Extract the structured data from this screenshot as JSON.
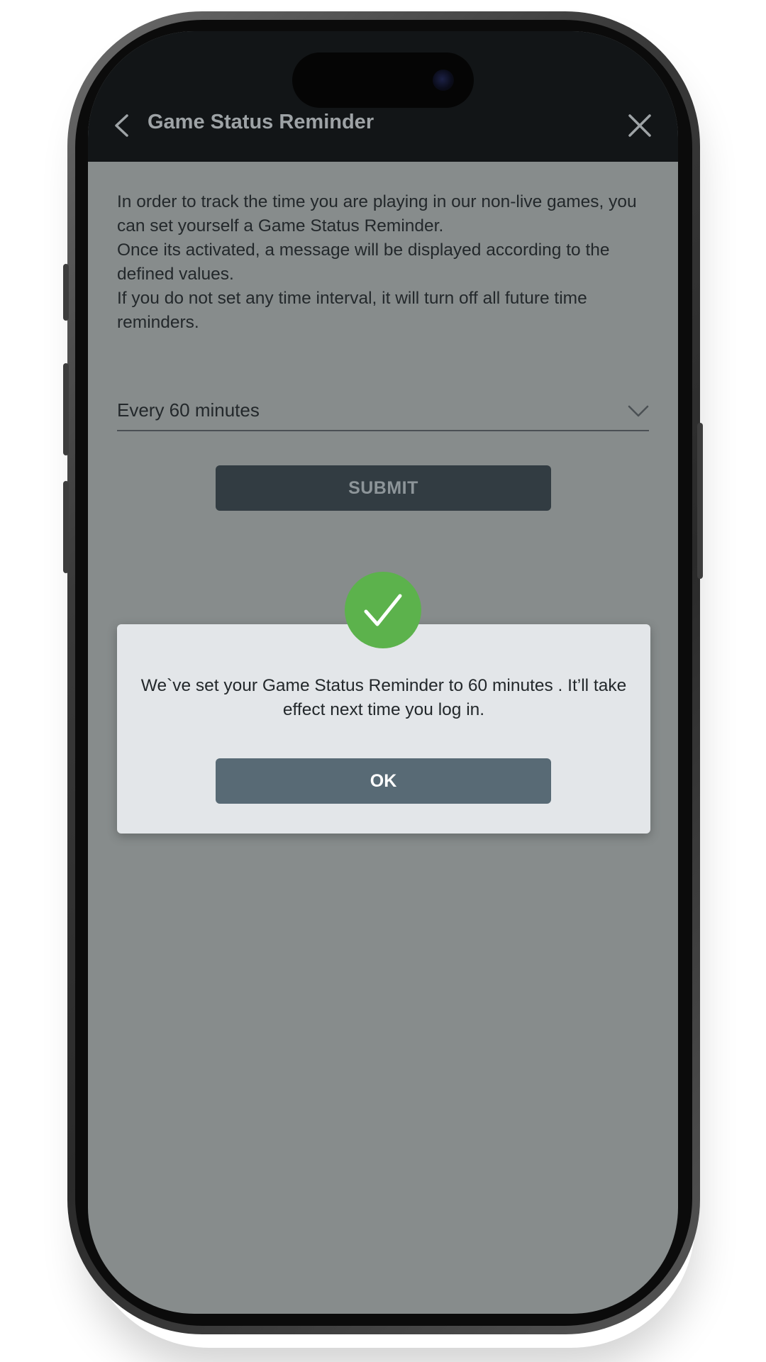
{
  "header": {
    "title": "Game Status Reminder",
    "back_icon": "chevron-left-icon",
    "close_icon": "close-icon"
  },
  "description": {
    "lines": [
      "In order to track the time you are playing in our non-live games, you can set yourself a Game Status Reminder.",
      "Once its activated, a message will be displayed according to the defined values.",
      "If you do not set any time interval, it will turn off all future time reminders."
    ]
  },
  "interval_select": {
    "value": "Every 60 minutes",
    "icon": "chevron-down-icon"
  },
  "submit": {
    "label": "SUBMIT"
  },
  "dialog": {
    "icon": "checkmark-icon",
    "message": "We`ve set your Game Status Reminder to 60 minutes . It’ll take effect next time you log in.",
    "ok_label": "OK"
  },
  "colors": {
    "header_bg": "#121517",
    "screen_overlay": "#878c8c",
    "submit_bg": "#323c42",
    "ok_bg": "#586a75",
    "success_green": "#5cb24c",
    "dialog_bg": "#e3e6e9"
  }
}
